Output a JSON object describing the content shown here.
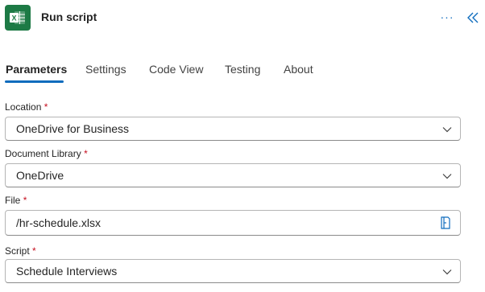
{
  "header": {
    "title": "Run script",
    "app_icon": "excel-icon",
    "more_icon": "more-horizontal-icon",
    "collapse_icon": "double-chevron-left-icon",
    "accent_color": "#0f6cbd",
    "excel_color": "#1d7a45"
  },
  "tabs": [
    {
      "label": "Parameters",
      "active": true
    },
    {
      "label": "Settings",
      "active": false
    },
    {
      "label": "Code View",
      "active": false
    },
    {
      "label": "Testing",
      "active": false
    },
    {
      "label": "About",
      "active": false
    }
  ],
  "fields": {
    "location": {
      "label": "Location",
      "required": "*",
      "value": "OneDrive for Business",
      "type": "dropdown"
    },
    "document_library": {
      "label": "Document Library",
      "required": "*",
      "value": "OneDrive",
      "type": "dropdown"
    },
    "file": {
      "label": "File",
      "required": "*",
      "value": "/hr-schedule.xlsx",
      "type": "file-picker",
      "icon": "file-picker-icon"
    },
    "script": {
      "label": "Script",
      "required": "*",
      "value": "Schedule Interviews",
      "type": "dropdown"
    }
  }
}
